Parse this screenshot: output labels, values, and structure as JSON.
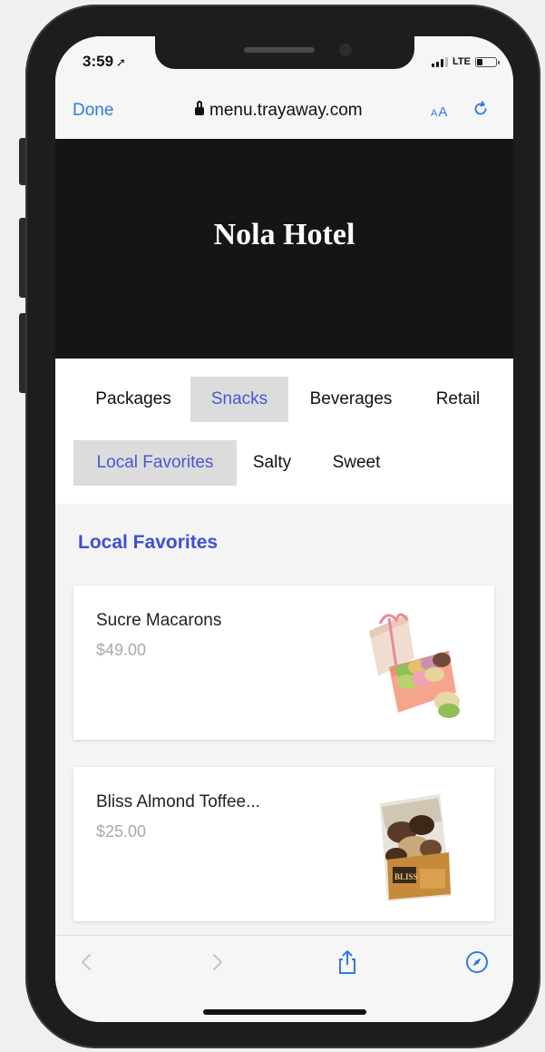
{
  "status": {
    "time": "3:59",
    "network": "LTE",
    "battery_level": 0.25
  },
  "browser": {
    "done_label": "Done",
    "url": "menu.trayaway.com",
    "text_size_label_small": "A",
    "text_size_label_large": "A"
  },
  "hero": {
    "title": "Nola Hotel"
  },
  "categories": [
    {
      "label": "Packages",
      "active": false
    },
    {
      "label": "Snacks",
      "active": true
    },
    {
      "label": "Beverages",
      "active": false
    },
    {
      "label": "Retail",
      "active": false
    }
  ],
  "subcategories": [
    {
      "label": "Local Favorites",
      "active": true
    },
    {
      "label": "Salty",
      "active": false
    },
    {
      "label": "Sweet",
      "active": false
    }
  ],
  "section": {
    "title": "Local Favorites"
  },
  "products": [
    {
      "name": "Sucre Macarons",
      "price": "$49.00",
      "image_icon": "macaron-box-image"
    },
    {
      "name": "Bliss Almond Toffee...",
      "price": "$25.00",
      "image_icon": "toffee-bag-image"
    }
  ],
  "toolbar": {
    "icons": [
      "back-icon",
      "forward-icon",
      "share-icon",
      "compass-icon"
    ]
  },
  "colors": {
    "accent_blue": "#2c7be5",
    "section_blue": "#3f4fd2",
    "hero_bg": "#151515",
    "tab_active_bg": "#dcdcdc"
  }
}
